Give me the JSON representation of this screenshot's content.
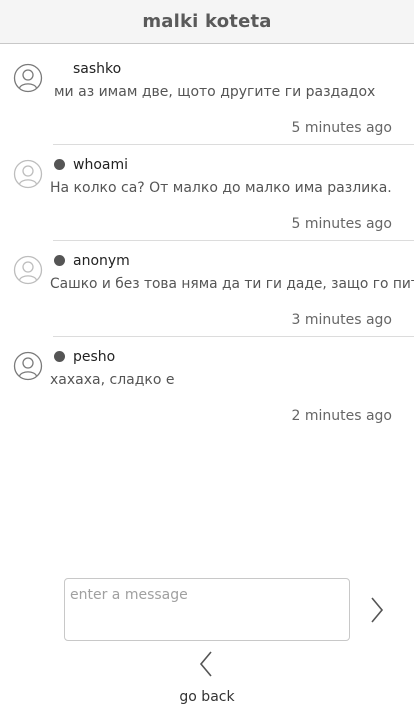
{
  "header": {
    "title": "malki koteta"
  },
  "messages": [
    {
      "username": "sashko",
      "online": false,
      "text": "ми аз имам две, щото другите ги раздадох",
      "time": "5 minutes ago"
    },
    {
      "username": "whoami",
      "online": true,
      "text": "На колко са? От малко до малко има разлика.",
      "time": "5 minutes ago"
    },
    {
      "username": "anonym",
      "online": true,
      "text": "Сашко и без това няма да ти ги даде, защо го питаш?",
      "time": "3 minutes ago"
    },
    {
      "username": "pesho",
      "online": true,
      "text": "хахаха, сладко е",
      "time": "2 minutes ago"
    }
  ],
  "composer": {
    "placeholder": "enter a message",
    "value": ""
  },
  "footer": {
    "go_back_label": "go back"
  },
  "icons": {
    "avatar": "user-avatar-icon",
    "send": "chevron-right-icon",
    "back": "chevron-left-icon"
  },
  "colors": {
    "status_dot": "#555555",
    "header_bg": "#f5f5f5"
  }
}
